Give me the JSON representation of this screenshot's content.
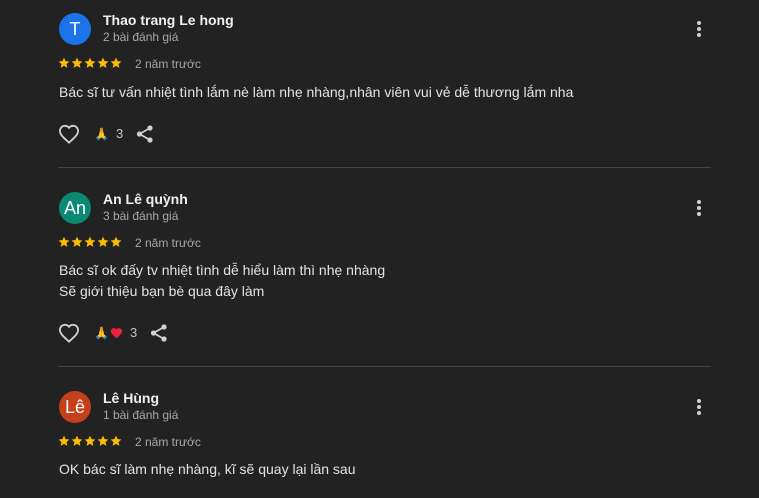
{
  "colors": {
    "background": "#222222",
    "star": "#fbbc04",
    "divider": "#454545"
  },
  "reviews": [
    {
      "avatar_letter": "T",
      "avatar_color": "#1a73e8",
      "name": "Thao trang Le hong",
      "review_count": "2 bài đánh giá",
      "rating": 5,
      "time": "2 năm trước",
      "text_lines": [
        "Bác sĩ tư vấn nhiệt tình lắm nè làm nhẹ nhàng,nhân viên vui vẻ dễ thương lắm nha"
      ],
      "reactions": {
        "emojis": [
          "folded-hands"
        ],
        "count": "3"
      }
    },
    {
      "avatar_letter": "An",
      "avatar_color": "#0a8a73",
      "name": "An Lê quỳnh",
      "review_count": "3 bài đánh giá",
      "rating": 5,
      "time": "2 năm trước",
      "text_lines": [
        "Bác sĩ ok đấy tv nhiệt tình dễ hiểu làm thì nhẹ nhàng",
        "Sẽ giới thiệu bạn bè qua đây làm"
      ],
      "reactions": {
        "emojis": [
          "folded-hands",
          "red-heart"
        ],
        "count": "3"
      }
    },
    {
      "avatar_letter": "Lê",
      "avatar_color": "#c5401a",
      "name": "Lê Hùng",
      "review_count": "1 bài đánh giá",
      "rating": 5,
      "time": "2 năm trước",
      "text_lines": [
        "OK bác sĩ làm nhẹ nhàng, kĩ sẽ quay lại lần sau"
      ]
    }
  ]
}
